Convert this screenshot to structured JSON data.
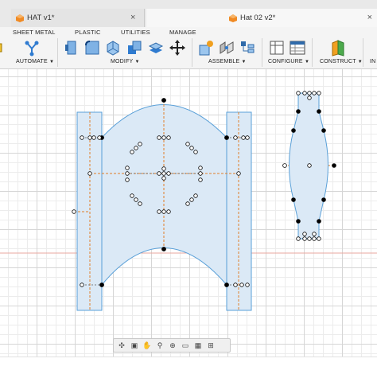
{
  "tabs": {
    "inactive_label": "HAT v1*",
    "active_label": "Hat 02 v2*",
    "close_glyph": "×"
  },
  "ribbon": {
    "tabs": [
      "SHEET METAL",
      "PLASTIC",
      "UTILITIES",
      "MANAGE"
    ],
    "groups": {
      "automate": "AUTOMATE",
      "modify": "MODIFY",
      "assemble": "ASSEMBLE",
      "configure": "CONFIGURE",
      "construct": "CONSTRUCT",
      "cut_off": "IN"
    }
  },
  "icons": {
    "automate": "automate-icon",
    "press_pull": "press-pull-icon",
    "fillet": "fillet-icon",
    "shell": "shell-icon",
    "combine": "combine-icon",
    "move": "move-icon",
    "new_component": "new-component-icon",
    "joint": "joint-icon",
    "as_built_joint": "assemble-component-icon",
    "configure_table": "configure-table-icon",
    "construct_plane": "construct-plane-icon"
  },
  "colors": {
    "sketch_fill": "#dbe9f6",
    "sketch_line": "#5aa0d8",
    "axis_red": "#e34b3a",
    "construction": "#e0802a",
    "point": "#000000",
    "accent_orange": "#f08a24"
  },
  "navbar": {
    "icons": [
      "orbit-icon",
      "look-at-icon",
      "pan-icon",
      "zoom-icon",
      "fit-icon",
      "display-settings-icon",
      "grid-settings-icon",
      "viewports-icon"
    ]
  }
}
